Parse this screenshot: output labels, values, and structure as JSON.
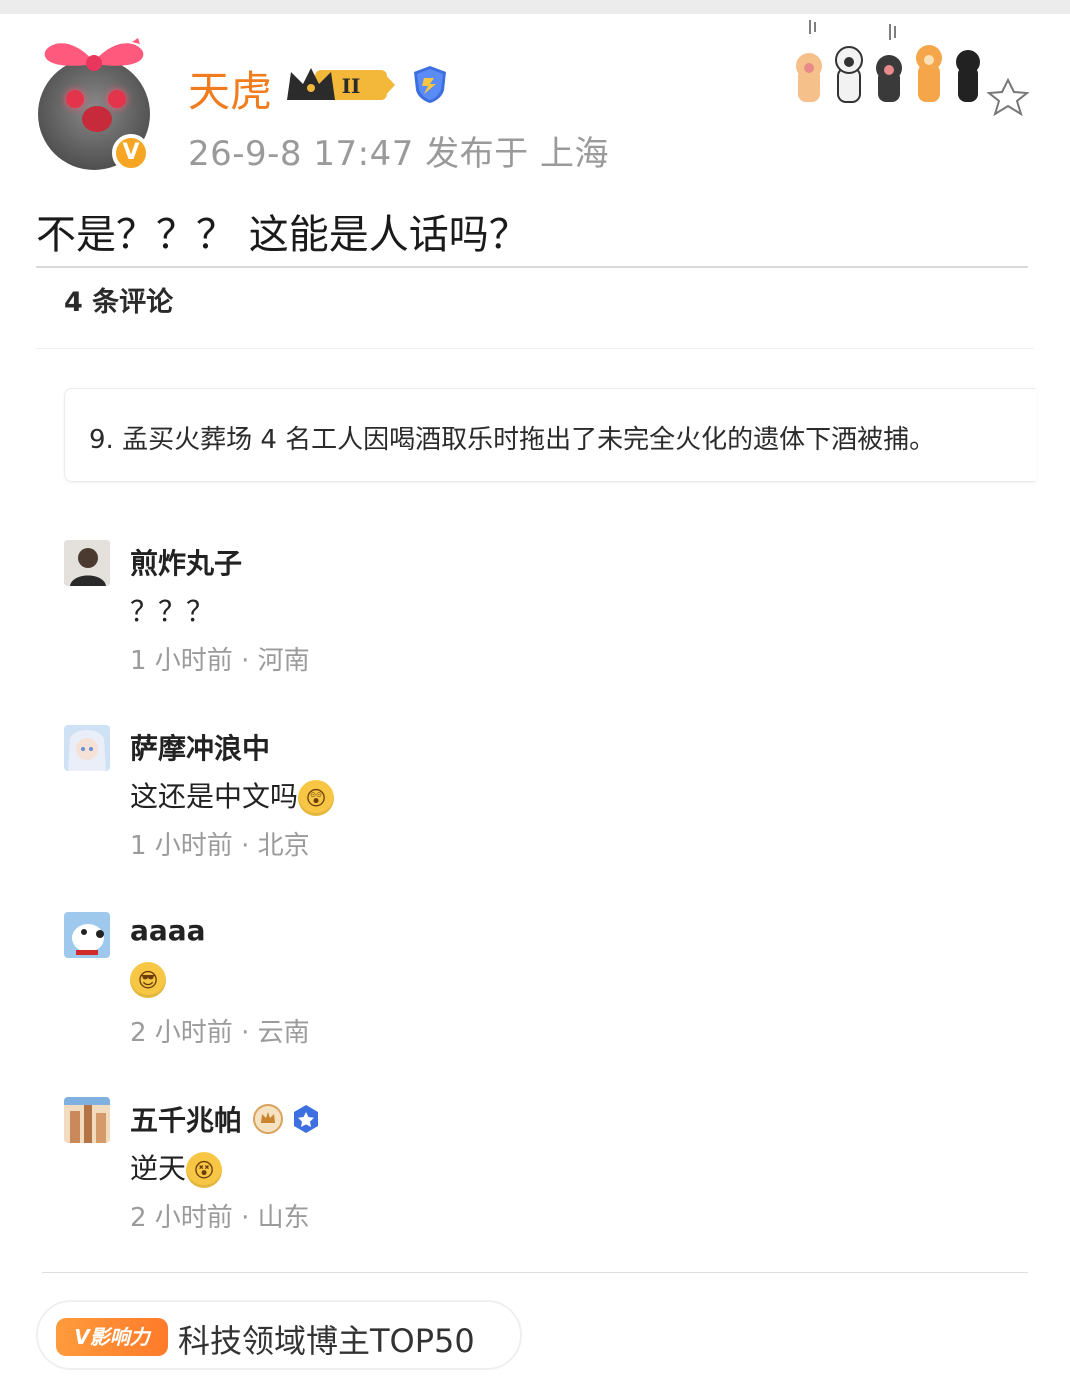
{
  "post": {
    "username": "天虎",
    "meta": "26-9-8 17:47   发布于 上海",
    "verified_badge": "V",
    "level_badge": "II",
    "text": "不是？？？ 这能是人话吗？"
  },
  "comments_section": {
    "count_label": "4 条评论",
    "quote": "9. 孟买火葬场 4 名工人因喝酒取乐时拖出了未完全火化的遗体下酒被捕。"
  },
  "comments": [
    {
      "name": "煎炸丸子",
      "text": "？？？",
      "meta": "1 小时前  ·  河南",
      "emoji": ""
    },
    {
      "name": "萨摩冲浪中",
      "text": "这还是中文吗",
      "meta": "1 小时前  ·  北京",
      "emoji": "astonished-emoji"
    },
    {
      "name": "aaaa",
      "text": "",
      "meta": "2 小时前  ·  云南",
      "emoji": "cool-emoji"
    },
    {
      "name": "五千兆帕",
      "text": "逆天",
      "meta": "2 小时前  ·  山东",
      "emoji": "dizzy-emoji"
    }
  ],
  "influence": {
    "badge": "V影响力",
    "text": "科技领域博主TOP50"
  },
  "colors": {
    "username": "#f07c1d",
    "meta_gray": "#9a9a9a",
    "influence_orange": "#ff8a33",
    "verified_blue": "#3d6fe0"
  }
}
